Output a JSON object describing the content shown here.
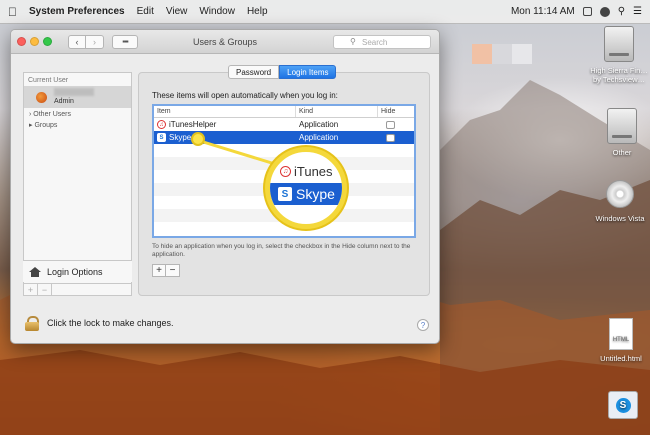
{
  "menubar": {
    "app_name": "System Preferences",
    "menus": [
      "Edit",
      "View",
      "Window",
      "Help"
    ],
    "clock": "Mon 11:14 AM"
  },
  "window": {
    "title": "Users & Groups",
    "search_placeholder": "Search"
  },
  "sidebar": {
    "current_user_header": "Current User",
    "current_user_role": "Admin",
    "other_users": "Other Users",
    "groups": "Groups",
    "login_options": "Login Options"
  },
  "tabs": [
    {
      "label": "Password",
      "active": false
    },
    {
      "label": "Login Items",
      "active": true
    }
  ],
  "login_items": {
    "intro": "These items will open automatically when you log in:",
    "columns": [
      "Item",
      "Kind",
      "Hide"
    ],
    "rows": [
      {
        "item": "iTunesHelper",
        "kind": "Application",
        "hide": false,
        "selected": false
      },
      {
        "item": "Skype",
        "kind": "Application",
        "hide": false,
        "selected": true
      }
    ],
    "hint": "To hide an application when you log in, select the checkbox in the Hide column next to the application."
  },
  "lock_text": "Click the lock to make changes.",
  "callout": {
    "itunes_text": "iTunes",
    "skype_text": "Skype"
  },
  "desktop_icons": [
    {
      "label": "High Sierra Fin… by Techsview…"
    },
    {
      "label": "Other"
    },
    {
      "label": "Windows Vista"
    },
    {
      "label": "Untitled.html"
    }
  ],
  "colors": {
    "selection": "#1b5fd0",
    "callout": "#f4d83b"
  }
}
